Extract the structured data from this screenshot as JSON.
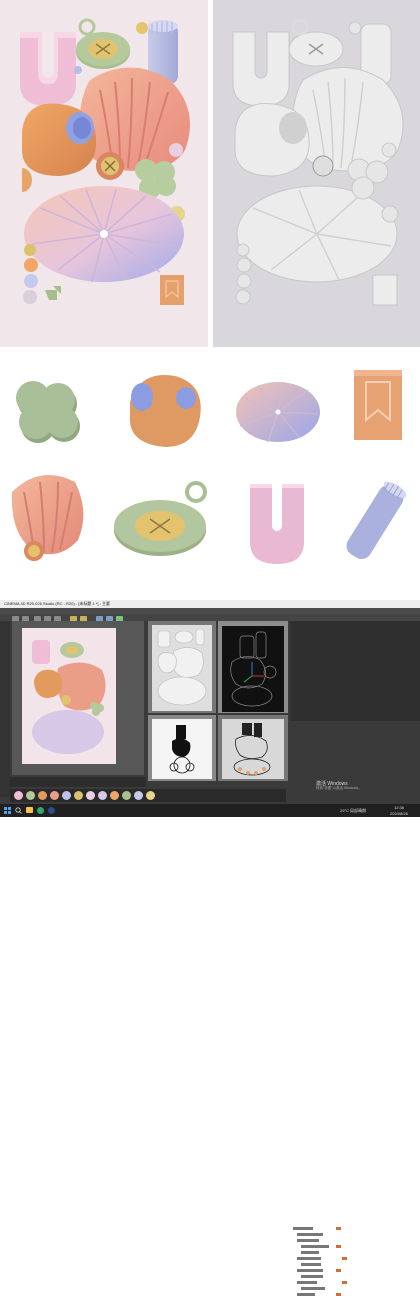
{
  "colors": {
    "left_bg": "#f1e6ea",
    "right_bg": "#d9d6dc",
    "mint": "#b6c99d",
    "pink_u": "#efbed6",
    "peach": "#ea9e88",
    "orange": "#e39a5d",
    "lavender": "#bcc2ea",
    "yellow": "#dec06c"
  },
  "c4d": {
    "window_title": "CINEMA 4D R20.026 Studio (RC - R20) - [未标题 1 *] - 主要",
    "watermark": "激活 Windows",
    "watermark_sub": "转到\"设置\"以激活 Windows。",
    "taskbar_weather": "29°C 局部晴朗",
    "taskbar_time": "12:36",
    "taskbar_date": "2024/8/26"
  },
  "icons": [
    "windows-start-icon",
    "search-icon",
    "folder-icon",
    "browser-icon",
    "c4d-app-icon"
  ]
}
